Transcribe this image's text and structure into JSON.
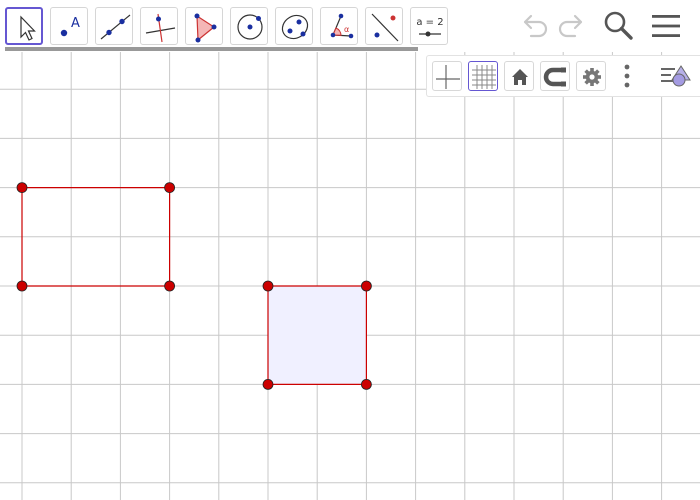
{
  "app": {
    "accent_color": "#6557d2",
    "grid_color": "#c8c8c8",
    "shape_stroke_color": "#cc0000",
    "point_fill_color": "#cc0000",
    "filled_shape_color": "#f0f0ff"
  },
  "toolbar": {
    "tools": [
      {
        "name": "move-tool-icon",
        "selected": true
      },
      {
        "name": "point-tool-icon",
        "label": "A"
      },
      {
        "name": "line-tool-icon"
      },
      {
        "name": "perpendicular-line-tool-icon"
      },
      {
        "name": "polygon-tool-icon"
      },
      {
        "name": "circle-tool-icon"
      },
      {
        "name": "ellipse-tool-icon"
      },
      {
        "name": "angle-tool-icon",
        "label": "α"
      },
      {
        "name": "reflect-tool-icon"
      },
      {
        "name": "slider-tool-icon",
        "label": "a = 2"
      }
    ],
    "undo_icon": "undo-icon",
    "redo_icon": "redo-icon",
    "search_icon": "search-icon",
    "menu_icon": "hamburger-menu-icon"
  },
  "graphics_bar": {
    "buttons": [
      {
        "name": "show-axes-icon",
        "active": false
      },
      {
        "name": "show-grid-icon",
        "active": true
      },
      {
        "name": "standard-view-icon",
        "active": false
      },
      {
        "name": "point-capturing-icon",
        "active": false
      },
      {
        "name": "graphics-settings-icon",
        "active": false
      },
      {
        "name": "more-options-icon",
        "active": false
      },
      {
        "name": "style-bar-toggle-icon",
        "active": false
      }
    ]
  },
  "canvas": {
    "grid": true,
    "shapes": [
      {
        "name": "rectangle-1",
        "points": [
          [
            0,
            0
          ],
          [
            3,
            0
          ],
          [
            3,
            2
          ],
          [
            0,
            2
          ]
        ],
        "filled": false
      },
      {
        "name": "square-2",
        "points": [
          [
            5,
            -2
          ],
          [
            7,
            -2
          ],
          [
            7,
            0
          ],
          [
            5,
            0
          ]
        ],
        "filled": true
      }
    ]
  }
}
